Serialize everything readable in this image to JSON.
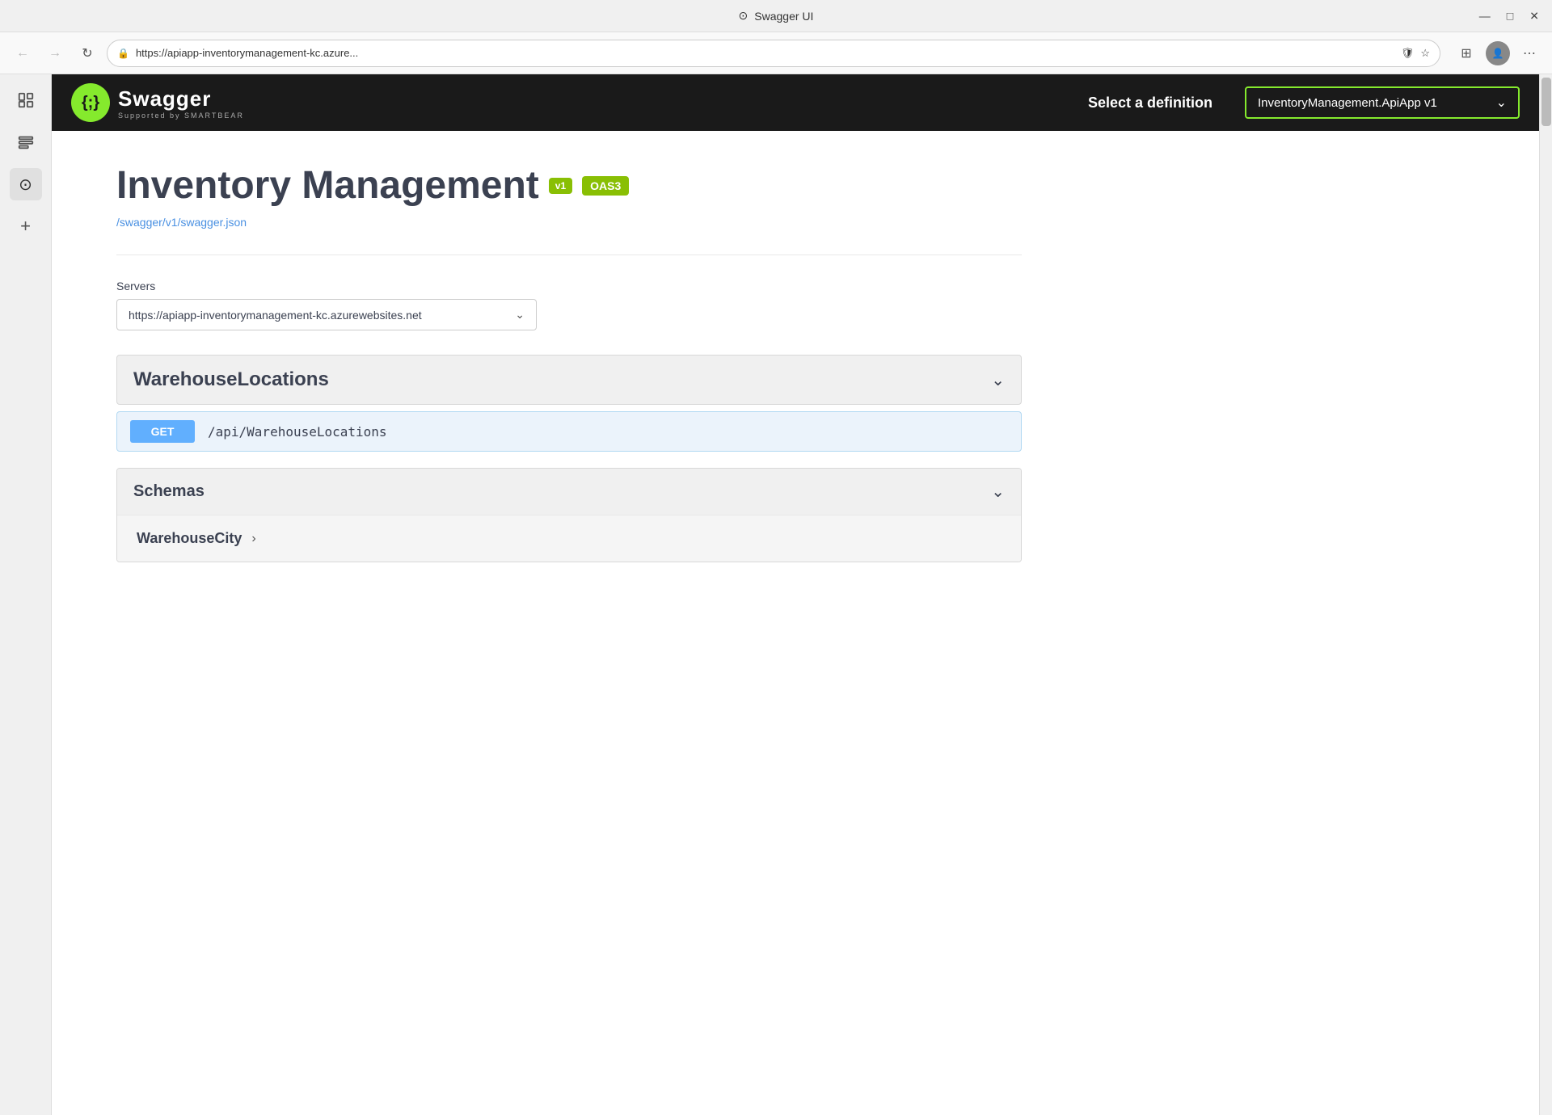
{
  "browser": {
    "titlebar": {
      "favicon": "⊙",
      "title": "Swagger UI",
      "minimize": "—",
      "maximize": "□",
      "close": "✕"
    },
    "toolbar": {
      "back_disabled": true,
      "forward_disabled": true,
      "refresh": "↻",
      "address": "https://apiapp-inventorymanagement-kc.azure...",
      "shield_icon": "🛡",
      "star_icon": "☆",
      "collections_icon": "⊞",
      "menu_icon": "⋯"
    },
    "sidebar_icons": [
      {
        "name": "bookmarks",
        "icon": "🔖"
      },
      {
        "name": "history",
        "icon": "📋"
      },
      {
        "name": "swagger-ext",
        "icon": "⊙"
      },
      {
        "name": "add",
        "icon": "+"
      }
    ]
  },
  "swagger": {
    "header": {
      "logo_icon": "{;}",
      "logo_name": "Swagger",
      "logo_sub": "Supported by SMARTBEAR",
      "select_definition_label": "Select a definition",
      "definition_dropdown": {
        "value": "InventoryManagement.ApiApp v1",
        "arrow": "⌄"
      }
    },
    "api": {
      "title": "Inventory Management",
      "version_badge": "v1",
      "oas_badge": "OAS3",
      "swagger_link": "/swagger/v1/swagger.json"
    },
    "servers": {
      "label": "Servers",
      "selected": "https://apiapp-inventorymanagement-kc.azurewebsites.net",
      "arrow": "⌄"
    },
    "sections": [
      {
        "name": "WarehouseLocations",
        "endpoints": [
          {
            "method": "GET",
            "path": "/api/WarehouseLocations"
          }
        ]
      }
    ],
    "schemas": {
      "title": "Schemas",
      "items": [
        {
          "name": "WarehouseCity"
        }
      ]
    }
  }
}
